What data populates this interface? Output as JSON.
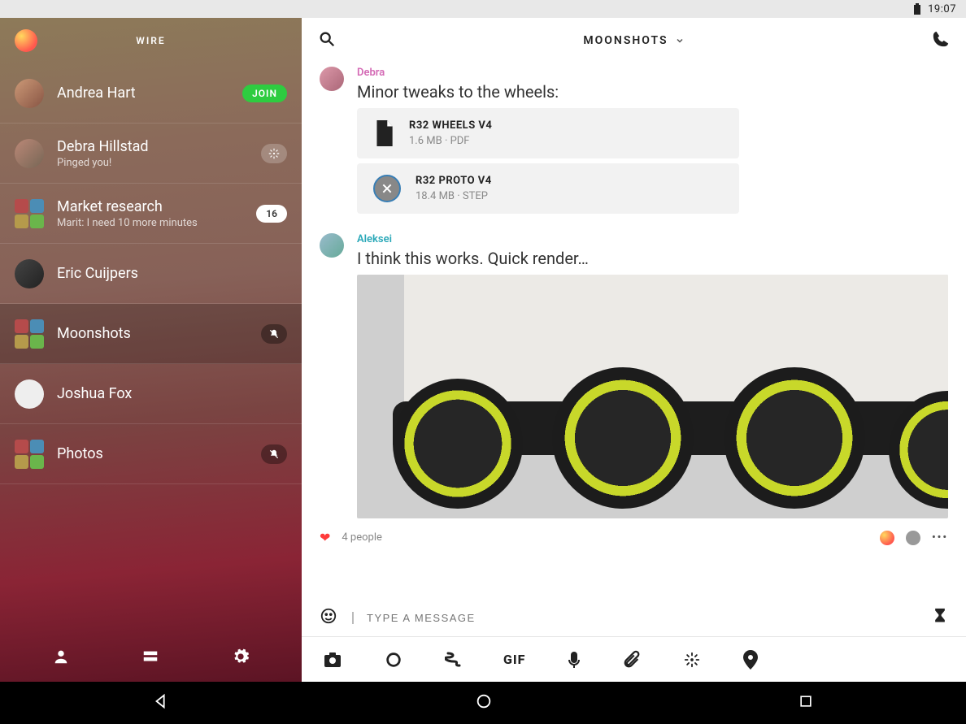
{
  "status": {
    "time": "19:07"
  },
  "sidebar": {
    "brand": "WIRE",
    "items": [
      {
        "name": "Andrea Hart",
        "sub": "",
        "badge_type": "join",
        "badge": "JOIN"
      },
      {
        "name": "Debra Hillstad",
        "sub": "Pinged you!",
        "badge_type": "ping",
        "badge": ""
      },
      {
        "name": "Market research",
        "sub": "Marit: I need 10 more minutes",
        "badge_type": "count",
        "badge": "16"
      },
      {
        "name": "Eric Cuijpers",
        "sub": "",
        "badge_type": "",
        "badge": ""
      },
      {
        "name": "Moonshots",
        "sub": "",
        "badge_type": "muted",
        "badge": ""
      },
      {
        "name": "Joshua Fox",
        "sub": "",
        "badge_type": "",
        "badge": ""
      },
      {
        "name": "Photos",
        "sub": "",
        "badge_type": "muted",
        "badge": ""
      }
    ]
  },
  "chat": {
    "title": "MOONSHOTS",
    "messages": {
      "m1": {
        "sender": "Debra",
        "text": "Minor tweaks to the wheels:",
        "files": [
          {
            "name": "R32 WHEELS V4",
            "size": "1.6 MB",
            "ext": "PDF"
          },
          {
            "name": "R32 PROTO V4",
            "size": "18.4 MB",
            "ext": "STEP"
          }
        ]
      },
      "m2": {
        "sender": "Aleksei",
        "text": "I think this works. Quick render…"
      }
    },
    "reactions": {
      "count_text": "4 people"
    },
    "compose": {
      "placeholder": "TYPE A MESSAGE"
    }
  }
}
